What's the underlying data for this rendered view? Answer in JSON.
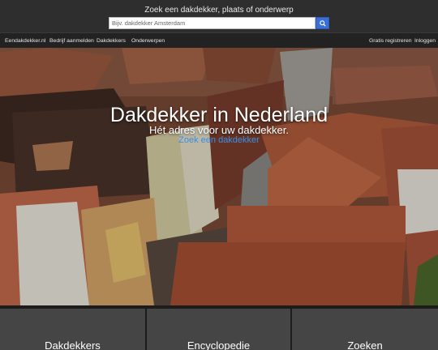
{
  "header": {
    "search_title": "Zoek een dakdekker, plaats of onderwerp",
    "search_placeholder": "Bijv. dakdekker Amsterdam",
    "search_button_icon": "search-icon"
  },
  "nav": {
    "left": [
      "Eendakdekker.nl",
      "Bedrijf aanmelden",
      "Dakdekkers",
      "Onderwerpen"
    ],
    "right": [
      "Gratis registreren",
      "Inloggen"
    ]
  },
  "hero": {
    "title": "Dakdekker in Nederland",
    "subtitle": "Hét adres voor uw dakdekker.",
    "link": "Zoek een dakdekker"
  },
  "tiles": [
    "Dakdekkers",
    "Encyclopedie",
    "Zoeken"
  ],
  "colors": {
    "accent": "#3b6fd8",
    "link": "#3d8de0",
    "topbar": "#2e2e2e",
    "navbar": "#222222",
    "tile": "#454545"
  }
}
